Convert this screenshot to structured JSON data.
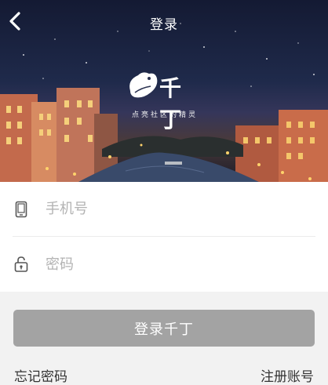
{
  "header": {
    "title": "登录",
    "back_icon": "chevron-left-icon"
  },
  "brand": {
    "logo_text": "千丁",
    "slogan": "点亮社区的精灵",
    "logo_icon": "bird-logo-icon"
  },
  "form": {
    "phone": {
      "placeholder": "手机号",
      "value": "",
      "icon": "phone-icon"
    },
    "password": {
      "placeholder": "密码",
      "value": "",
      "icon": "unlock-icon"
    }
  },
  "actions": {
    "login_label": "登录千丁",
    "forgot_label": "忘记密码",
    "register_label": "注册账号"
  },
  "colors": {
    "button_disabled": "#a3a3a3",
    "page_bg": "#f2f2f2"
  }
}
